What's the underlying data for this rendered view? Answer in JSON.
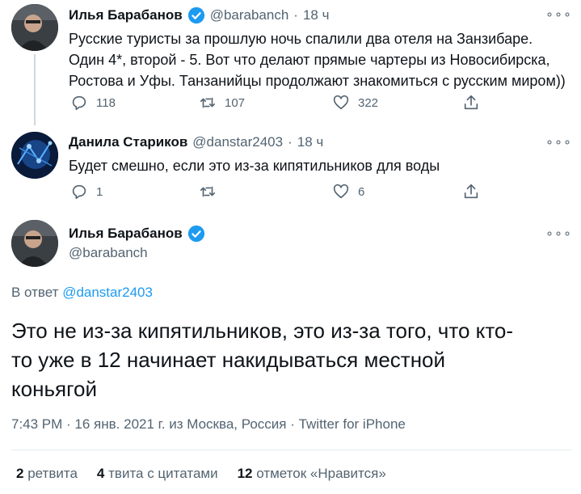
{
  "tweet1": {
    "name": "Илья Барабанов",
    "handle": "@barabanch",
    "time": "18 ч",
    "text_line1": "Русские туристы за прошлую ночь спалили два отеля на Занзибаре.",
    "text_line2": "Один 4*, второй - 5. Вот что делают прямые чартеры из Новосибирска,",
    "text_line3": "Ростова и Уфы. Танзанийцы продолжают знакомиться с русским миром))",
    "replies": "118",
    "retweets": "107",
    "likes": "322",
    "more": "∘∘∘"
  },
  "tweet2": {
    "name": "Данила Стариков",
    "handle": "@danstar2403",
    "time": "18 ч",
    "text": "Будет смешно, если это из-за кипятильников для воды",
    "replies": "1",
    "likes": "6",
    "more": "∘∘∘"
  },
  "main": {
    "name": "Илья Барабанов",
    "handle": "@barabanch",
    "more": "∘∘∘",
    "reply_prefix": "В ответ",
    "reply_to": "@danstar2403",
    "text_line1": "Это не из-за кипятильников, это из-за того, что кто-",
    "text_line2": "то уже в 12 начинает накидываться местной",
    "text_line3": "коньягой",
    "meta": "7:43 PM · 16 янв. 2021 г. из Москва, Россия · Twitter for iPhone"
  },
  "stats": {
    "retweets_count": "2",
    "retweets_label": "ретвита",
    "quotes_count": "4",
    "quotes_label": "твита с цитатами",
    "likes_count": "12",
    "likes_label": "отметок «Нравится»"
  },
  "colors": {
    "accent": "#1d9bf0",
    "secondary_text": "#536471",
    "border": "#e6ecf0"
  },
  "icons": [
    "reply-icon",
    "retweet-icon",
    "like-icon",
    "share-icon",
    "verified-badge-icon",
    "more-icon"
  ]
}
